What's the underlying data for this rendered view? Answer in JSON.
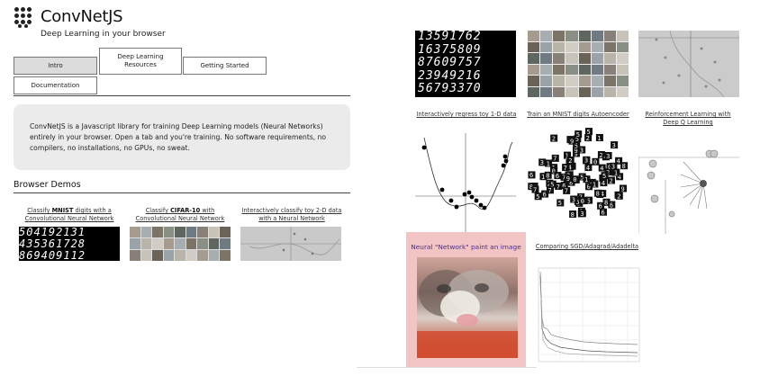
{
  "app": {
    "title": "ConvNetJS",
    "subtitle": "Deep Learning in your browser"
  },
  "tabs": [
    {
      "label": "Intro",
      "active": true
    },
    {
      "label": "Deep Learning Resources",
      "active": false
    },
    {
      "label": "Getting Started",
      "active": false
    },
    {
      "label": "Documentation",
      "active": false
    }
  ],
  "intro": {
    "text": "ConvNetJS is a Javascript library for training Deep Learning models (Neural Networks) entirely in your browser. Open a tab and you're training. No software requirements, no compilers, no installations, no GPUs, no sweat."
  },
  "browser_demos": {
    "heading": "Browser Demos",
    "items": [
      {
        "pre": "Classify ",
        "bold": "MNIST",
        "post": " digits with a Convolutional Neural Network"
      },
      {
        "pre": "Classify ",
        "bold": "CIFAR-10",
        "post": " with Convolutional Neural Network"
      },
      {
        "pre": "",
        "bold": "",
        "post": "Interactively classify toy 2-D data with a Neural Network"
      }
    ]
  },
  "mnist_digits": [
    "504192131",
    "435361728",
    "869409112"
  ],
  "right_demos": {
    "mnist_rows": [
      "13591762",
      "16375809",
      "87609757",
      "23949216",
      "56793370"
    ],
    "links": {
      "regress": "Interactively regress toy 1-D data",
      "autoencoder": "Train an MNIST digits Autoencoder",
      "rl": "Reinforcement Learning with Deep Q Learning",
      "style": "Neural \"Network\" paint an image",
      "compare": "Comparing SGD/Adagrad/Adadelta"
    }
  },
  "colors": {
    "active_tab": "#dcdcdc",
    "intro_bg": "#ebebeb",
    "style_box_bg": "#f2c4c4",
    "style_title": "#4b2f8a"
  }
}
